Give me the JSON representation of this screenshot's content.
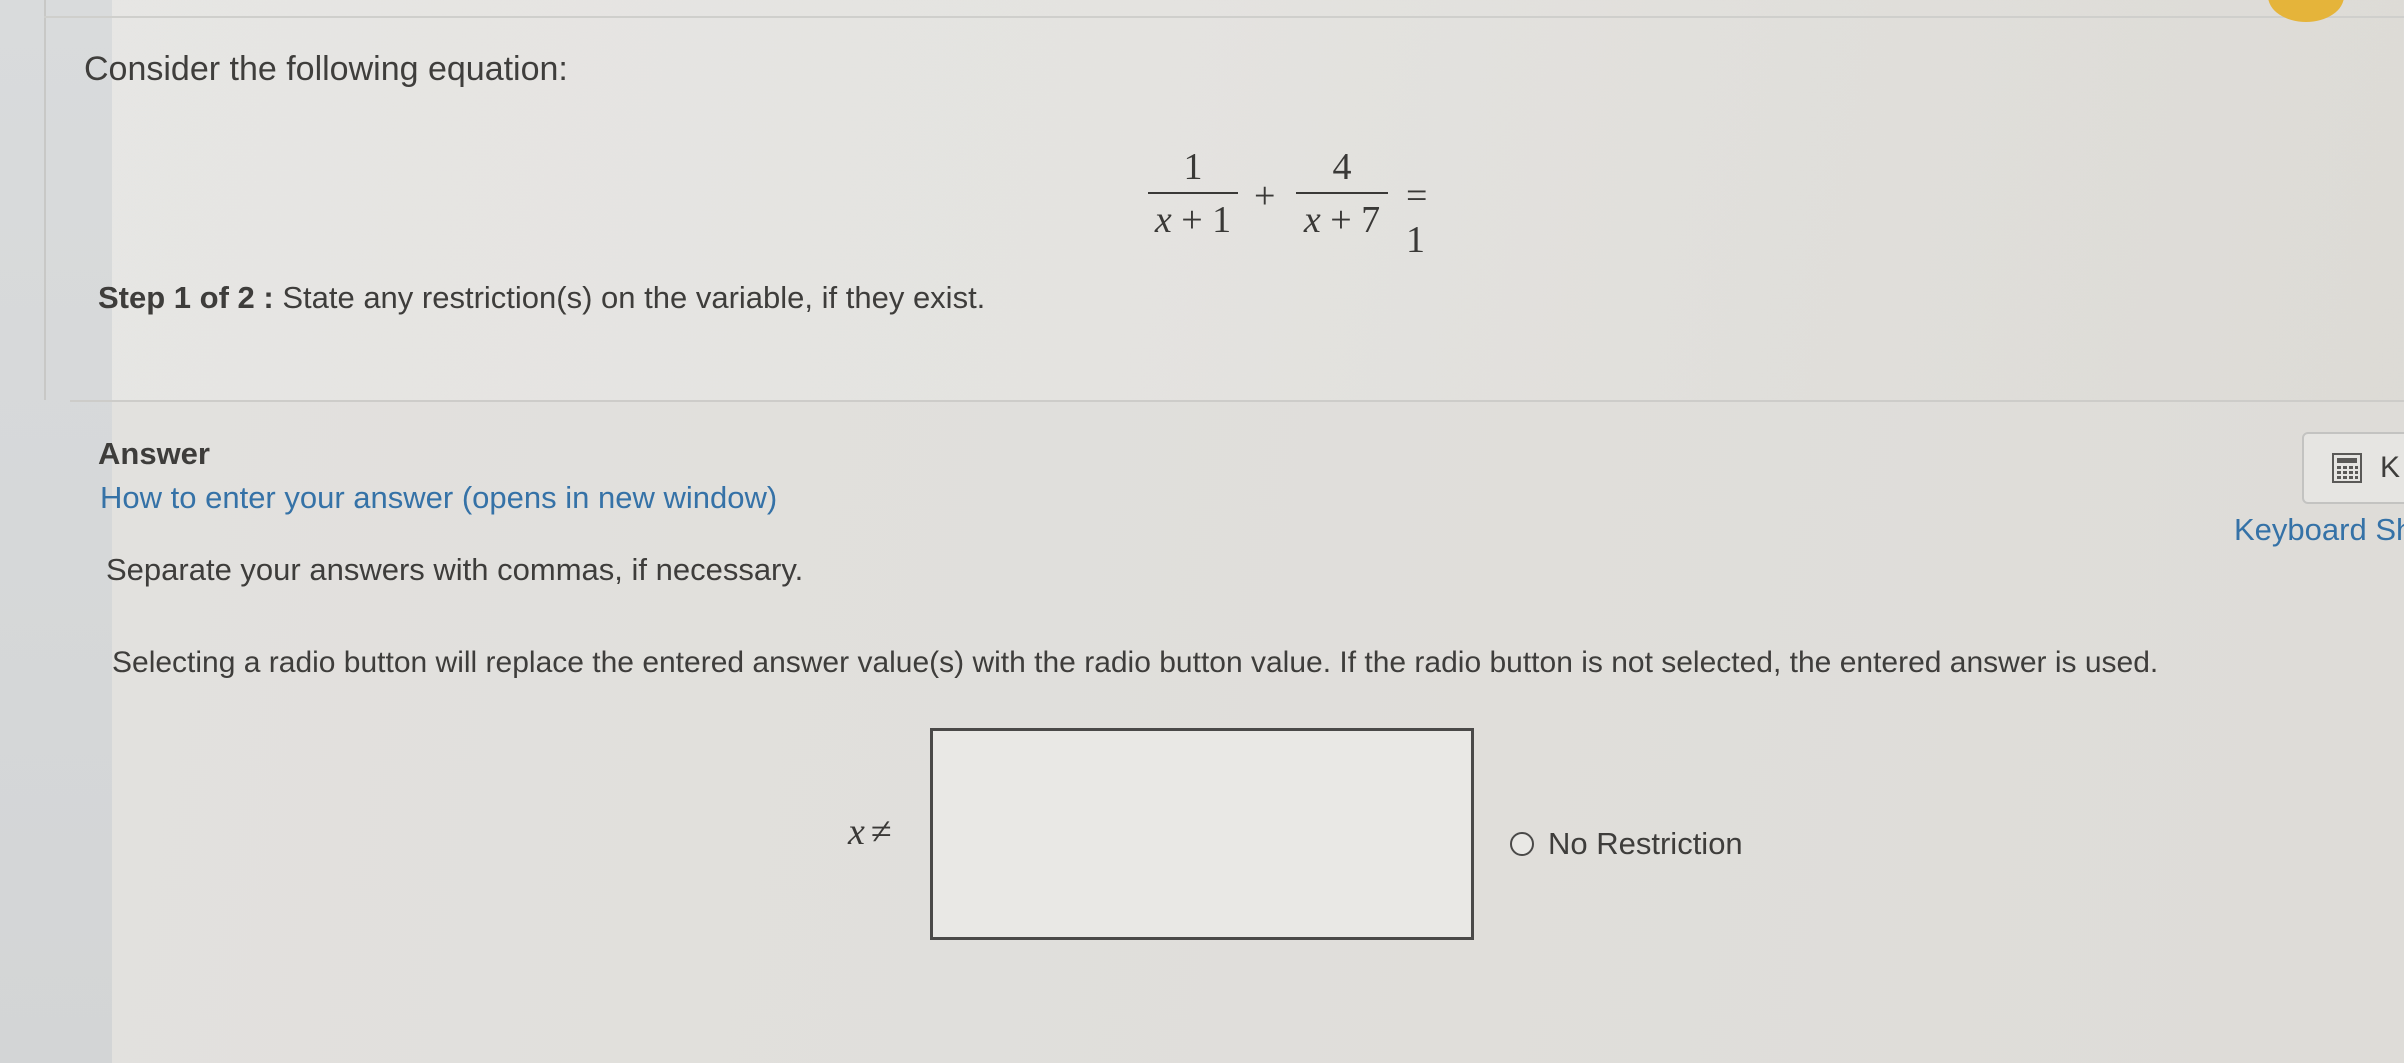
{
  "question": {
    "prompt": "Consider the following equation:",
    "equation": {
      "frac1_num": "1",
      "frac1_den_var": "x",
      "frac1_den_rest": " + 1",
      "plus": "+",
      "frac2_num": "4",
      "frac2_den_var": "x",
      "frac2_den_rest": " + 7",
      "equals": "= 1"
    },
    "step_label": "Step 1 of 2 :",
    "step_text": " State any restriction(s) on the variable, if they exist."
  },
  "answer": {
    "heading": "Answer",
    "howto_link": "How to enter your answer (opens in new window)",
    "separate_text": "Separate your answers with commas, if necessary.",
    "radio_info": "Selecting a radio button will replace the entered answer value(s) with the radio button value. If the radio button is not selected, the entered answer is used.",
    "keyboard_button_label": "K",
    "keyboard_shortcuts_link": "Keyboard Sh",
    "input_prefix_var": "x",
    "input_prefix_symbol": "≠",
    "input_value": "",
    "radio_option_label": "No Restriction"
  },
  "colors": {
    "link": "#3572a7",
    "text": "#3e3d3b",
    "badge": "#e5b43a"
  },
  "icons": {
    "keyboard_button_icon": "calculator-icon"
  }
}
